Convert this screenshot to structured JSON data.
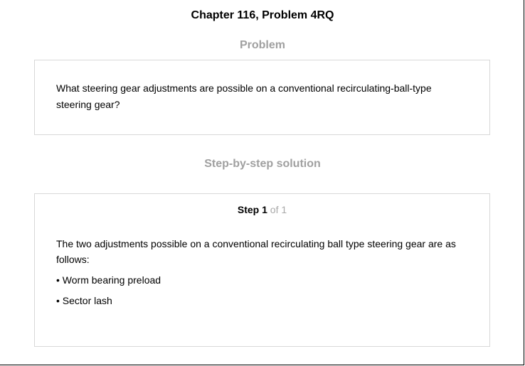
{
  "header": {
    "title": "Chapter 116, Problem 4RQ"
  },
  "problem": {
    "heading": "Problem",
    "text": "What steering gear adjustments are possible on a conventional recirculating-ball-type steering gear?"
  },
  "solution": {
    "heading": "Step-by-step solution",
    "step_label": "Step",
    "step_number": "1",
    "step_of": "of 1",
    "text": "The two adjustments possible on a conventional recirculating ball type steering gear are as follows:",
    "bullets": [
      "• Worm bearing preload",
      "• Sector lash"
    ]
  },
  "colors": {
    "heading_gray": "#a0a0a0",
    "card_border": "#d8d8d8",
    "step_of_gray": "#a8a8a8",
    "text": "#000000",
    "background": "#ffffff"
  }
}
